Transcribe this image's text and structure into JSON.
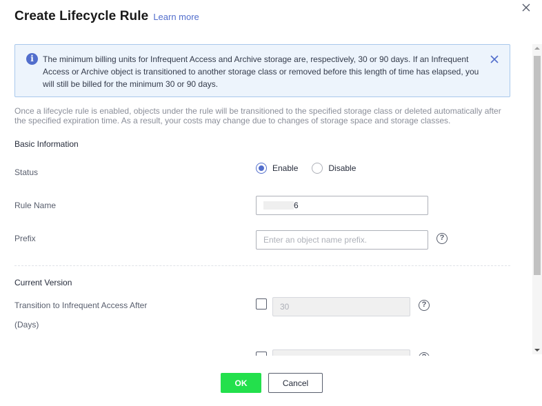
{
  "dialog": {
    "title": "Create Lifecycle Rule",
    "learn_more": "Learn more",
    "close_icon": "close-icon"
  },
  "alert": {
    "icon": "info-icon",
    "text": "The minimum billing units for Infrequent Access and Archive storage are, respectively, 30 or 90 days. If an Infrequent Access or Archive object is transitioned to another storage class or removed before this length of time has elapsed, you will still be billed for the minimum 30 or 90 days.",
    "close_icon": "close-icon",
    "color": "#526ecc"
  },
  "description": "Once a lifecycle rule is enabled, objects under the rule will be transitioned to the specified storage class or deleted automatically after the specified expiration time. As a result, your costs may change due to changes of storage space and storage classes.",
  "basic": {
    "section_title": "Basic Information",
    "status": {
      "label": "Status",
      "options": [
        "Enable",
        "Disable"
      ],
      "selected": "Enable"
    },
    "rule_name": {
      "label": "Rule Name",
      "value": "6"
    },
    "prefix": {
      "label": "Prefix",
      "placeholder": "Enter an object name prefix.",
      "value": ""
    }
  },
  "current_version": {
    "section_title": "Current Version",
    "transition_ia": {
      "label_line1": "Transition to Infrequent Access After",
      "label_line2": "(Days)",
      "checked": false,
      "value": "30"
    }
  },
  "footer": {
    "ok_label": "OK",
    "cancel_label": "Cancel",
    "ok_color": "#23e04c"
  }
}
